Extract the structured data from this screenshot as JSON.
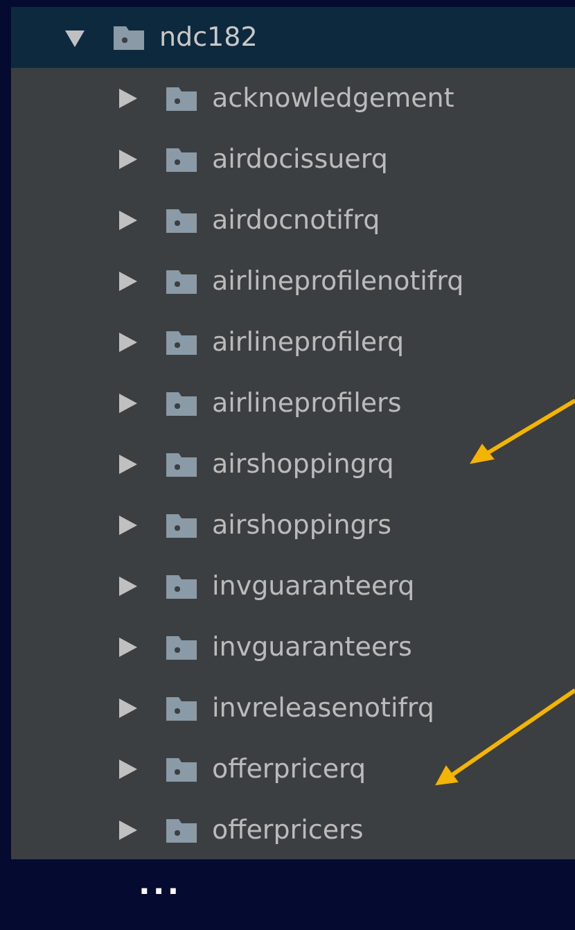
{
  "tree": [
    {
      "label": "ndc182",
      "expanded": true,
      "selected": true,
      "children": [
        {
          "label": "acknowledgement",
          "expanded": false,
          "selected": false
        },
        {
          "label": "airdocissuerq",
          "expanded": false,
          "selected": false
        },
        {
          "label": "airdocnotifrq",
          "expanded": false,
          "selected": false
        },
        {
          "label": "airlineprofilenotifrq",
          "expanded": false,
          "selected": false
        },
        {
          "label": "airlineprofilerq",
          "expanded": false,
          "selected": false
        },
        {
          "label": "airlineprofilers",
          "expanded": false,
          "selected": false
        },
        {
          "label": "airshoppingrq",
          "expanded": false,
          "selected": false
        },
        {
          "label": "airshoppingrs",
          "expanded": false,
          "selected": false
        },
        {
          "label": "invguaranteerq",
          "expanded": false,
          "selected": false
        },
        {
          "label": "invguaranteers",
          "expanded": false,
          "selected": false
        },
        {
          "label": "invreleasenotifrq",
          "expanded": false,
          "selected": false
        },
        {
          "label": "offerpricerq",
          "expanded": false,
          "selected": false
        },
        {
          "label": "offerpricers",
          "expanded": false,
          "selected": false
        }
      ]
    }
  ],
  "ellipsis": "..."
}
